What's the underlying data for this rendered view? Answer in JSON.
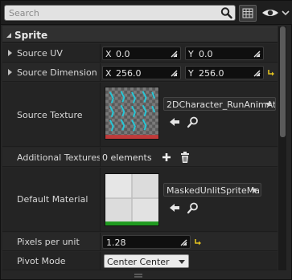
{
  "search": {
    "placeholder": "Search"
  },
  "section": {
    "title": "Sprite"
  },
  "rows": {
    "source_uv": {
      "label": "Source UV",
      "x_axis": "X",
      "x_value": "0.0",
      "y_axis": "Y",
      "y_value": "0.0"
    },
    "source_dimension": {
      "label": "Source Dimension",
      "x_axis": "X",
      "x_value": "256.0",
      "y_axis": "Y",
      "y_value": "256.0"
    },
    "source_texture": {
      "label": "Source Texture",
      "asset": "2DCharacter_RunAnimAt"
    },
    "additional_textures": {
      "label": "Additional Textures",
      "count": "0 elements"
    },
    "default_material": {
      "label": "Default Material",
      "asset": "MaskedUnlitSpriteMa"
    },
    "pixels_per_unit": {
      "label": "Pixels per unit",
      "value": "1.28"
    },
    "pivot_mode": {
      "label": "Pivot Mode",
      "value": "Center Center"
    }
  },
  "colors": {
    "reset_arrow": "#e0c020",
    "texture_cyan": "#25c8d8",
    "texture_red": "#c03a3a",
    "material_green": "#1f9a1f"
  },
  "icons": [
    "search-icon",
    "grid-view-icon",
    "eye-icon",
    "drag-handle-icon",
    "reset-to-default-icon",
    "use-selected-arrow-icon",
    "browse-magnifier-icon",
    "add-plus-icon",
    "trash-icon"
  ]
}
